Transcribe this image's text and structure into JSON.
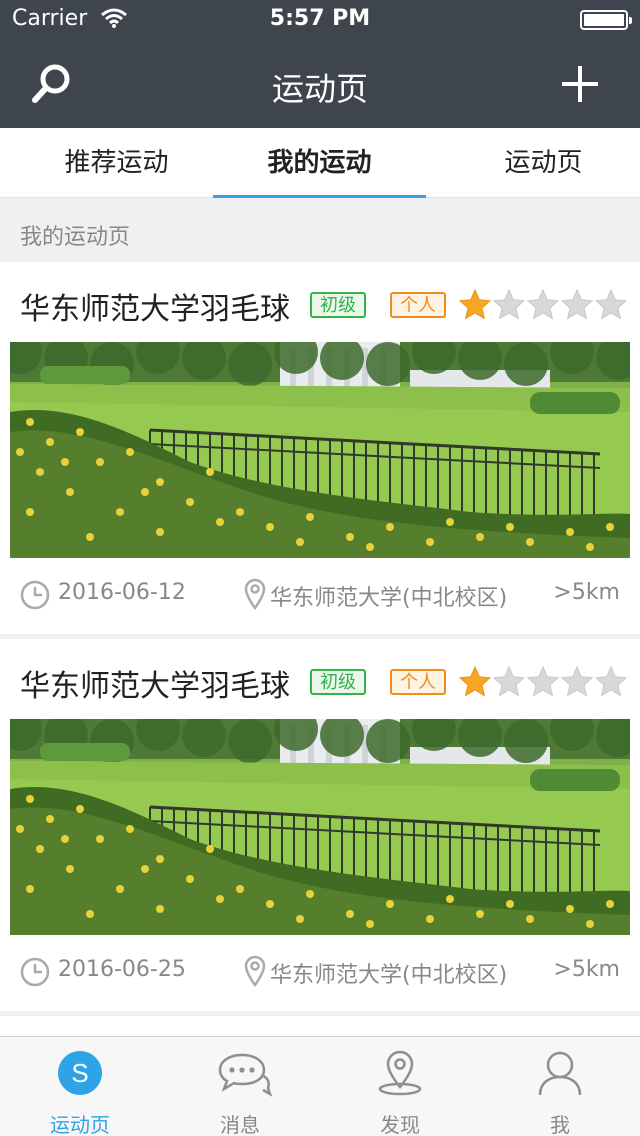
{
  "status_bar": {
    "carrier": "Carrier",
    "time": "5:57 PM"
  },
  "nav": {
    "title": "运动页",
    "search_icon": "search-icon",
    "add_icon": "plus-icon"
  },
  "tabs": [
    {
      "label": "推荐运动",
      "active": false
    },
    {
      "label": "我的运动",
      "active": true
    },
    {
      "label": "运动页",
      "active": false
    }
  ],
  "section_title": "我的运动页",
  "activities": [
    {
      "title": "华东师范大学羽毛球",
      "level": "初级",
      "mode": "个人",
      "rating": 1,
      "rating_max": 5,
      "date": "2016-06-12",
      "location": "华东师范大学(中北校区)",
      "distance": ">5km"
    },
    {
      "title": "华东师范大学羽毛球",
      "level": "初级",
      "mode": "个人",
      "rating": 1,
      "rating_max": 5,
      "date": "2016-06-25",
      "location": "华东师范大学(中北校区)",
      "distance": ">5km"
    }
  ],
  "tab_bar": [
    {
      "label": "运动页",
      "icon": "sport-s-icon",
      "active": true
    },
    {
      "label": "消息",
      "icon": "chat-bubbles-icon",
      "active": false
    },
    {
      "label": "发现",
      "icon": "location-pin-icon",
      "active": false
    },
    {
      "label": "我",
      "icon": "person-icon",
      "active": false
    }
  ],
  "colors": {
    "nav_bg": "#3f454d",
    "accent": "#2ea3e6",
    "star_on": "#f6a623",
    "star_off": "#d8d8d8",
    "level_green": "#35b24a",
    "mode_orange": "#f08c1e"
  }
}
